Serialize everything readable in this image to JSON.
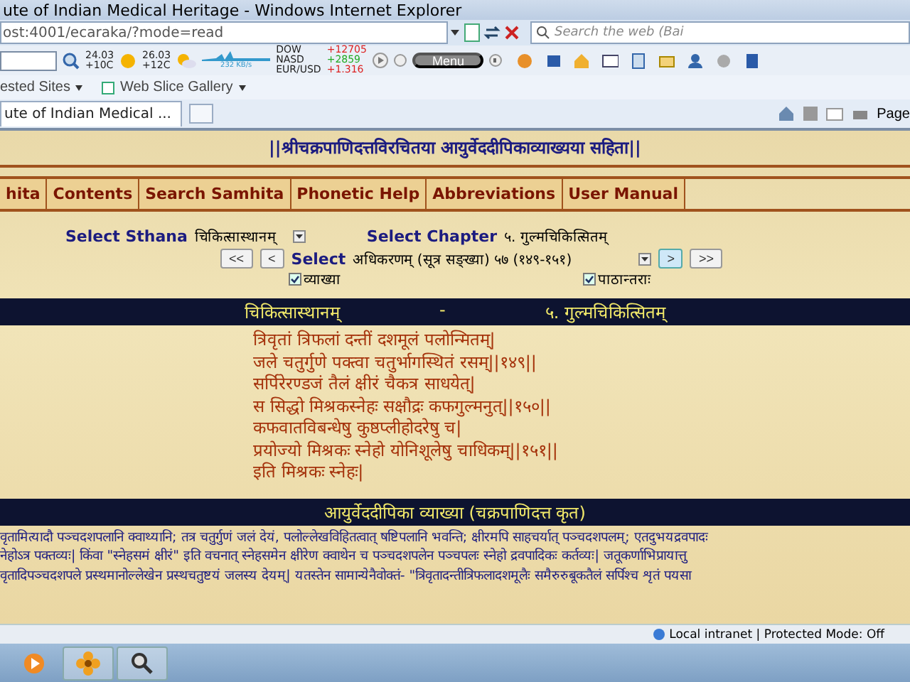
{
  "window": {
    "title": "ute of Indian Medical Heritage - Windows Internet Explorer"
  },
  "address_bar": {
    "url": "ost:4001/ecaraka/?mode=read"
  },
  "search": {
    "placeholder": "Search the web (Bai"
  },
  "toolbar": {
    "weather": [
      {
        "date": "24.03",
        "temp": "+10C",
        "kind": "sun"
      },
      {
        "date": "26.03",
        "temp": "+12C",
        "kind": "cloud"
      }
    ],
    "traffic": "232 KB/s",
    "markets": [
      "DOW",
      "NASD",
      "EUR/USD"
    ],
    "quotes": [
      "+12705",
      "+2859",
      "+1.316"
    ],
    "menu": "Menu"
  },
  "favorites_bar": [
    "ested Sites",
    "Web Slice Gallery"
  ],
  "tab": {
    "title": "ute of Indian Medical ..."
  },
  "command_bar": {
    "page": "Page"
  },
  "page": {
    "heading": "||श्रीचक्रपाणिदत्तविरचितया आयुर्वेददीपिकाव्याख्यया सहिता||",
    "nav": [
      {
        "label": "hita",
        "selected": false
      },
      {
        "label": "Contents",
        "selected": false
      },
      {
        "label": "Search Samhita",
        "selected": false
      },
      {
        "label": "Phonetic Help",
        "selected": false
      },
      {
        "label": "Abbreviations",
        "selected": false
      },
      {
        "label": "User Manual",
        "selected": false
      }
    ],
    "sthana": {
      "label": "Select Sthana",
      "value": "चिकित्सास्थानम्"
    },
    "chapter": {
      "label": "Select Chapter",
      "value": "५. गुल्मचिकित्सितम्"
    },
    "adhikarana": {
      "label": "Select",
      "value": "अधिकरणम् (सूत्र सङ्ख्या)   ५७ (१४९-१५१)",
      "buttons": [
        "<<",
        "<",
        ">",
        ">>"
      ]
    },
    "options": [
      {
        "label": "व्याख्या",
        "checked": true
      },
      {
        "label": "पाठान्तराः",
        "checked": true
      }
    ],
    "section_bar": [
      "चिकित्सास्थानम्",
      "-",
      "५. गुल्मचिकित्सितम्"
    ],
    "verses": [
      "त्रिवृतां त्रिफलां दन्तीं दशमूलं पलोन्मितम्|",
      "जले चतुर्गुणे पक्त्वा चतुर्भागस्थितं रसम्||१४९||",
      "सर्पिरेरण्डजं तैलं क्षीरं चैकत्र साधयेत्|",
      "स सिद्धो मिश्रकस्नेहः सक्षौद्रः कफगुल्मनुत्||१५०||",
      "कफवातविबन्धेषु कुष्ठप्लीहोदरेषु च|",
      "प्रयोज्यो मिश्रकः स्नेहो योनिशूलेषु चाधिकम्||१५१||",
      "इति मिश्रकः स्नेहः|"
    ],
    "commentary_title": "आयुर्वेददीपिका व्याख्या (चक्रपाणिदत्त कृत)",
    "commentary": [
      "वृतामित्यादौ पञ्चदशपलानि क्वाथ्यानि; तत्र चतुर्गुणं जलं देयं, पलोल्लेखविहितत्वात् षष्टिपलानि भवन्ति; क्षीरमपि साहचर्यात् पञ्चदशपलम्; एतदुभयद्रवपादः",
      "नेहोऽत्र पक्तव्यः| किंवा \"स्नेहसमं क्षीरं\" इति वचनात् स्नेहसमेन क्षीरेण क्वाथेन च पञ्चदशपलेन पञ्चपलः स्नेहो द्रवपादिकः कर्तव्यः| जतूकर्णाभिप्रायात्तु",
      "वृतादिपञ्चदशपले प्रस्थमानोल्लेखेन प्रस्थचतुष्टयं जलस्य देयम्| यतस्तेन सामान्येनैवोक्तं- \"त्रिवृतादन्तीत्रिफलादशमूलैः समैरुरुबूकतैलं सर्पिश्च शृतं पयसा"
    ]
  },
  "status_bar": {
    "zone": "Local intranet | Protected Mode: Off"
  }
}
